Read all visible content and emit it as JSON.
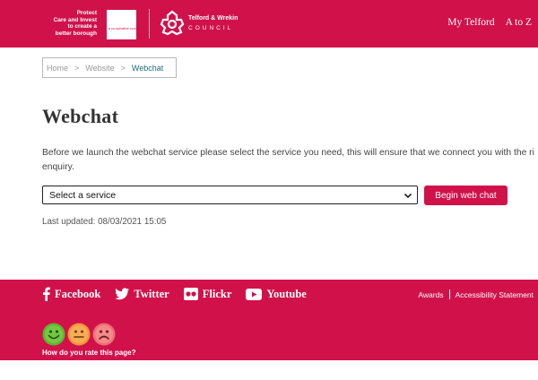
{
  "header": {
    "tagline_lines": [
      "Protect",
      "Care and Invest",
      "to create a",
      "better borough"
    ],
    "coop_logo_text": "a co-operative council",
    "council_name_line1": "Telford & Wrekin",
    "council_name_line2": "COUNCIL",
    "nav": [
      {
        "label": "My Telford"
      },
      {
        "label": "A to Z"
      }
    ],
    "brand_color": "#d1114a"
  },
  "breadcrumb": {
    "items": [
      "Home",
      "Website",
      "Webchat"
    ],
    "separator": ">"
  },
  "main": {
    "title": "Webchat",
    "intro_line1": "Before we launch the webchat service please select the service you need, this will ensure that we connect you with the ri",
    "intro_line2": "enquiry.",
    "select": {
      "selected": "Select a service"
    },
    "begin_button": "Begin web chat",
    "last_updated": "Last updated: 08/03/2021 15:05"
  },
  "footer": {
    "social": [
      {
        "label": "Facebook",
        "icon": "facebook-icon"
      },
      {
        "label": "Twitter",
        "icon": "twitter-icon"
      },
      {
        "label": "Flickr",
        "icon": "flickr-icon"
      },
      {
        "label": "Youtube",
        "icon": "youtube-icon"
      }
    ],
    "links": [
      "Awards",
      "Accessibility Statement"
    ],
    "rating": {
      "question": "How do you rate this page?",
      "options": [
        {
          "icon": "happy-face-icon",
          "color": "#5cb82e"
        },
        {
          "icon": "neutral-face-icon",
          "color": "#f0963a"
        },
        {
          "icon": "sad-face-icon",
          "color": "#ec6f72"
        }
      ]
    }
  }
}
